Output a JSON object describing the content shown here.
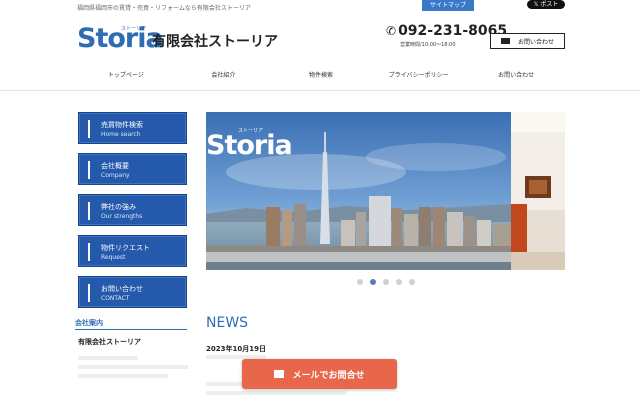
{
  "top": {
    "tagline": "福岡県福岡市の賃貸・売買・リフォームなら有限会社ストーリア",
    "sitemap": "サイトマップ",
    "x_post": "𝕏 ポスト"
  },
  "header": {
    "logo": "Storia",
    "logo_kana": "ストーリア",
    "company": "有限会社ストーリア",
    "phone": "092-231-8065",
    "hours": "営業時間/10:00～18:00",
    "contact": "お問い合わせ"
  },
  "nav": [
    {
      "label": "トップページ"
    },
    {
      "label": "会社紹介"
    },
    {
      "label": "物件検索"
    },
    {
      "label": "プライバシーポリシー"
    },
    {
      "label": "お問い合わせ"
    }
  ],
  "side_menu": [
    {
      "jp": "売買物件検索",
      "en": "Home search"
    },
    {
      "jp": "会社概要",
      "en": "Company"
    },
    {
      "jp": "弊社の強み",
      "en": "Our strengths"
    },
    {
      "jp": "物件リクエスト",
      "en": "Request"
    },
    {
      "jp": "お問い合わせ",
      "en": "CONTACT"
    }
  ],
  "company_box": {
    "heading": "会社案内",
    "name": "有限会社ストーリア"
  },
  "slider": {
    "logo": "Storia",
    "logo_kana": "ストーリア",
    "dots": 5,
    "active_dot": 2
  },
  "news": {
    "title": "NEWS",
    "date": "2023年10月19日"
  },
  "float": {
    "mail": "メールでお問合せ"
  },
  "colors": {
    "brand": "#2e6db4",
    "menu": "#2459ab",
    "accent": "#e8674b"
  }
}
